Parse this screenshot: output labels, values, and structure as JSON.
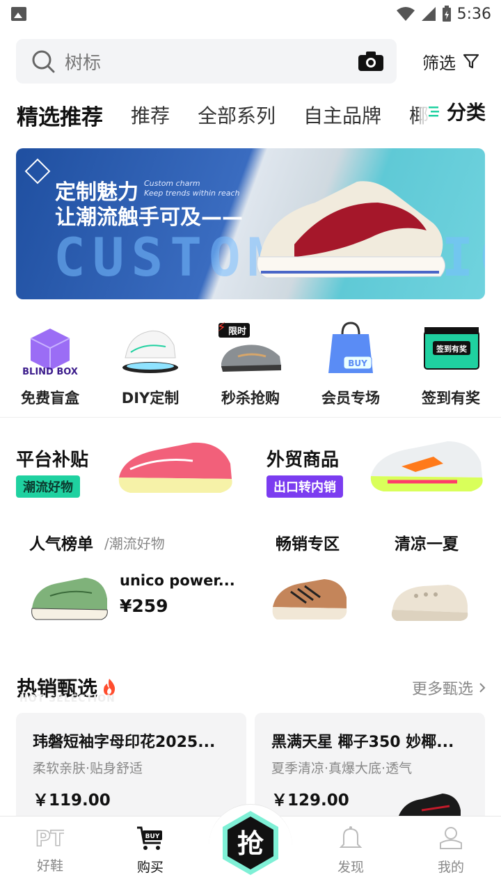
{
  "status_bar": {
    "time": "5:36"
  },
  "search": {
    "placeholder": "树标",
    "filter_label": "筛选"
  },
  "tabs": [
    {
      "label": "精选推荐"
    },
    {
      "label": "推荐"
    },
    {
      "label": "全部系列"
    },
    {
      "label": "自主品牌"
    },
    {
      "label": "椰子"
    }
  ],
  "categories_label": "分类",
  "banner": {
    "line1": "定制魅力",
    "line2": "让潮流触手可及——",
    "english": "Custom charm\nKeep trends within reach",
    "big_text": "CUSTOMIZATION"
  },
  "quick_links": [
    {
      "label": "免费盲盒",
      "image_text": "BLIND BOX"
    },
    {
      "label": "DIY定制"
    },
    {
      "label": "秒杀抢购",
      "badge": "限时"
    },
    {
      "label": "会员专场",
      "image_text": "BUY"
    },
    {
      "label": "签到有奖",
      "image_text": "签到有奖"
    }
  ],
  "promos": [
    {
      "title": "平台补贴",
      "tag": "潮流好物",
      "tag_color": "#1fd1a0"
    },
    {
      "title": "外贸商品",
      "tag": "出口转内销",
      "tag_color": "#7b3cf0"
    }
  ],
  "rank": {
    "title": "人气榜单",
    "subtitle": "/潮流好物",
    "product_name": "unico power...",
    "price": "¥259"
  },
  "sections": [
    {
      "title": "畅销专区"
    },
    {
      "title": "清凉一夏"
    }
  ],
  "hot": {
    "title": "热销甄选",
    "ghost": "HOT SELECTION",
    "more_label": "更多甄选"
  },
  "products": [
    {
      "name": "玮磐短袖字母印花2025...",
      "desc": "柔软亲肤·贴身舒适",
      "price": "￥119.00"
    },
    {
      "name": "黑满天星 椰子350 妙椰...",
      "desc": "夏季清凉·真爆大底·透气",
      "price": "￥129.00"
    }
  ],
  "bottom_nav": [
    {
      "label": "好鞋",
      "icon": "pt-icon"
    },
    {
      "label": "购买",
      "icon": "cart-icon"
    },
    {
      "label": "抢",
      "icon": "grab-icon"
    },
    {
      "label": "发现",
      "icon": "bell-icon"
    },
    {
      "label": "我的",
      "icon": "profile-icon"
    }
  ],
  "colors": {
    "accent": "#1fd1a0",
    "purple_tag": "#7b3cf0"
  }
}
